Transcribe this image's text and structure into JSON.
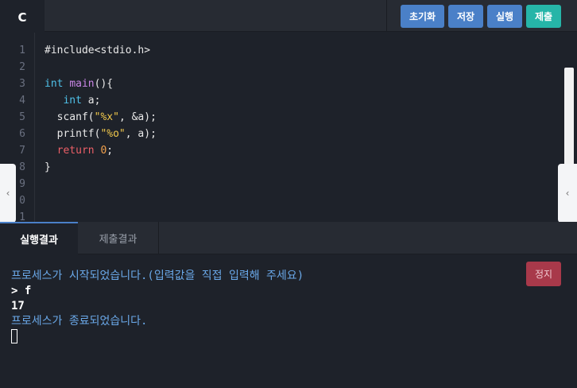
{
  "toolbar": {
    "language": "C",
    "reset_label": "초기화",
    "save_label": "저장",
    "run_label": "실행",
    "submit_label": "제출"
  },
  "editor": {
    "line_numbers": [
      "1",
      "2",
      "3",
      "4",
      "5",
      "6",
      "7",
      "8",
      "9",
      "0",
      "1"
    ],
    "code": {
      "l1": "#include<stdio.h>",
      "l3_type": "int",
      "l3_name": "main",
      "l3_rest": "(){",
      "l4_type": "int",
      "l4_rest": " a;",
      "l5_fn": "scanf(",
      "l5_str": "\"%x\"",
      "l5_rest": ", &a);",
      "l6_fn": "printf(",
      "l6_str": "\"%o\"",
      "l6_rest": ", a);",
      "l7_kw": "return",
      "l7_num": "0",
      "l7_rest": ";",
      "l8": "}"
    }
  },
  "results": {
    "tabs": [
      "실행결과",
      "제출결과"
    ],
    "stop_label": "정지",
    "console_lines": [
      "프로세스가 시작되었습니다.(입력값을 직접 입력해 주세요)",
      "> f",
      "17",
      "프로세스가 종료되었습니다."
    ]
  },
  "icons": {
    "left_handle": "chevron-left-icon",
    "right_handle": "chevron-left-icon"
  },
  "colors": {
    "accent_blue": "#4a80c8",
    "submit_teal": "#26b5a8",
    "stop_red": "#a8394a",
    "console_info": "#6aa8e8"
  }
}
